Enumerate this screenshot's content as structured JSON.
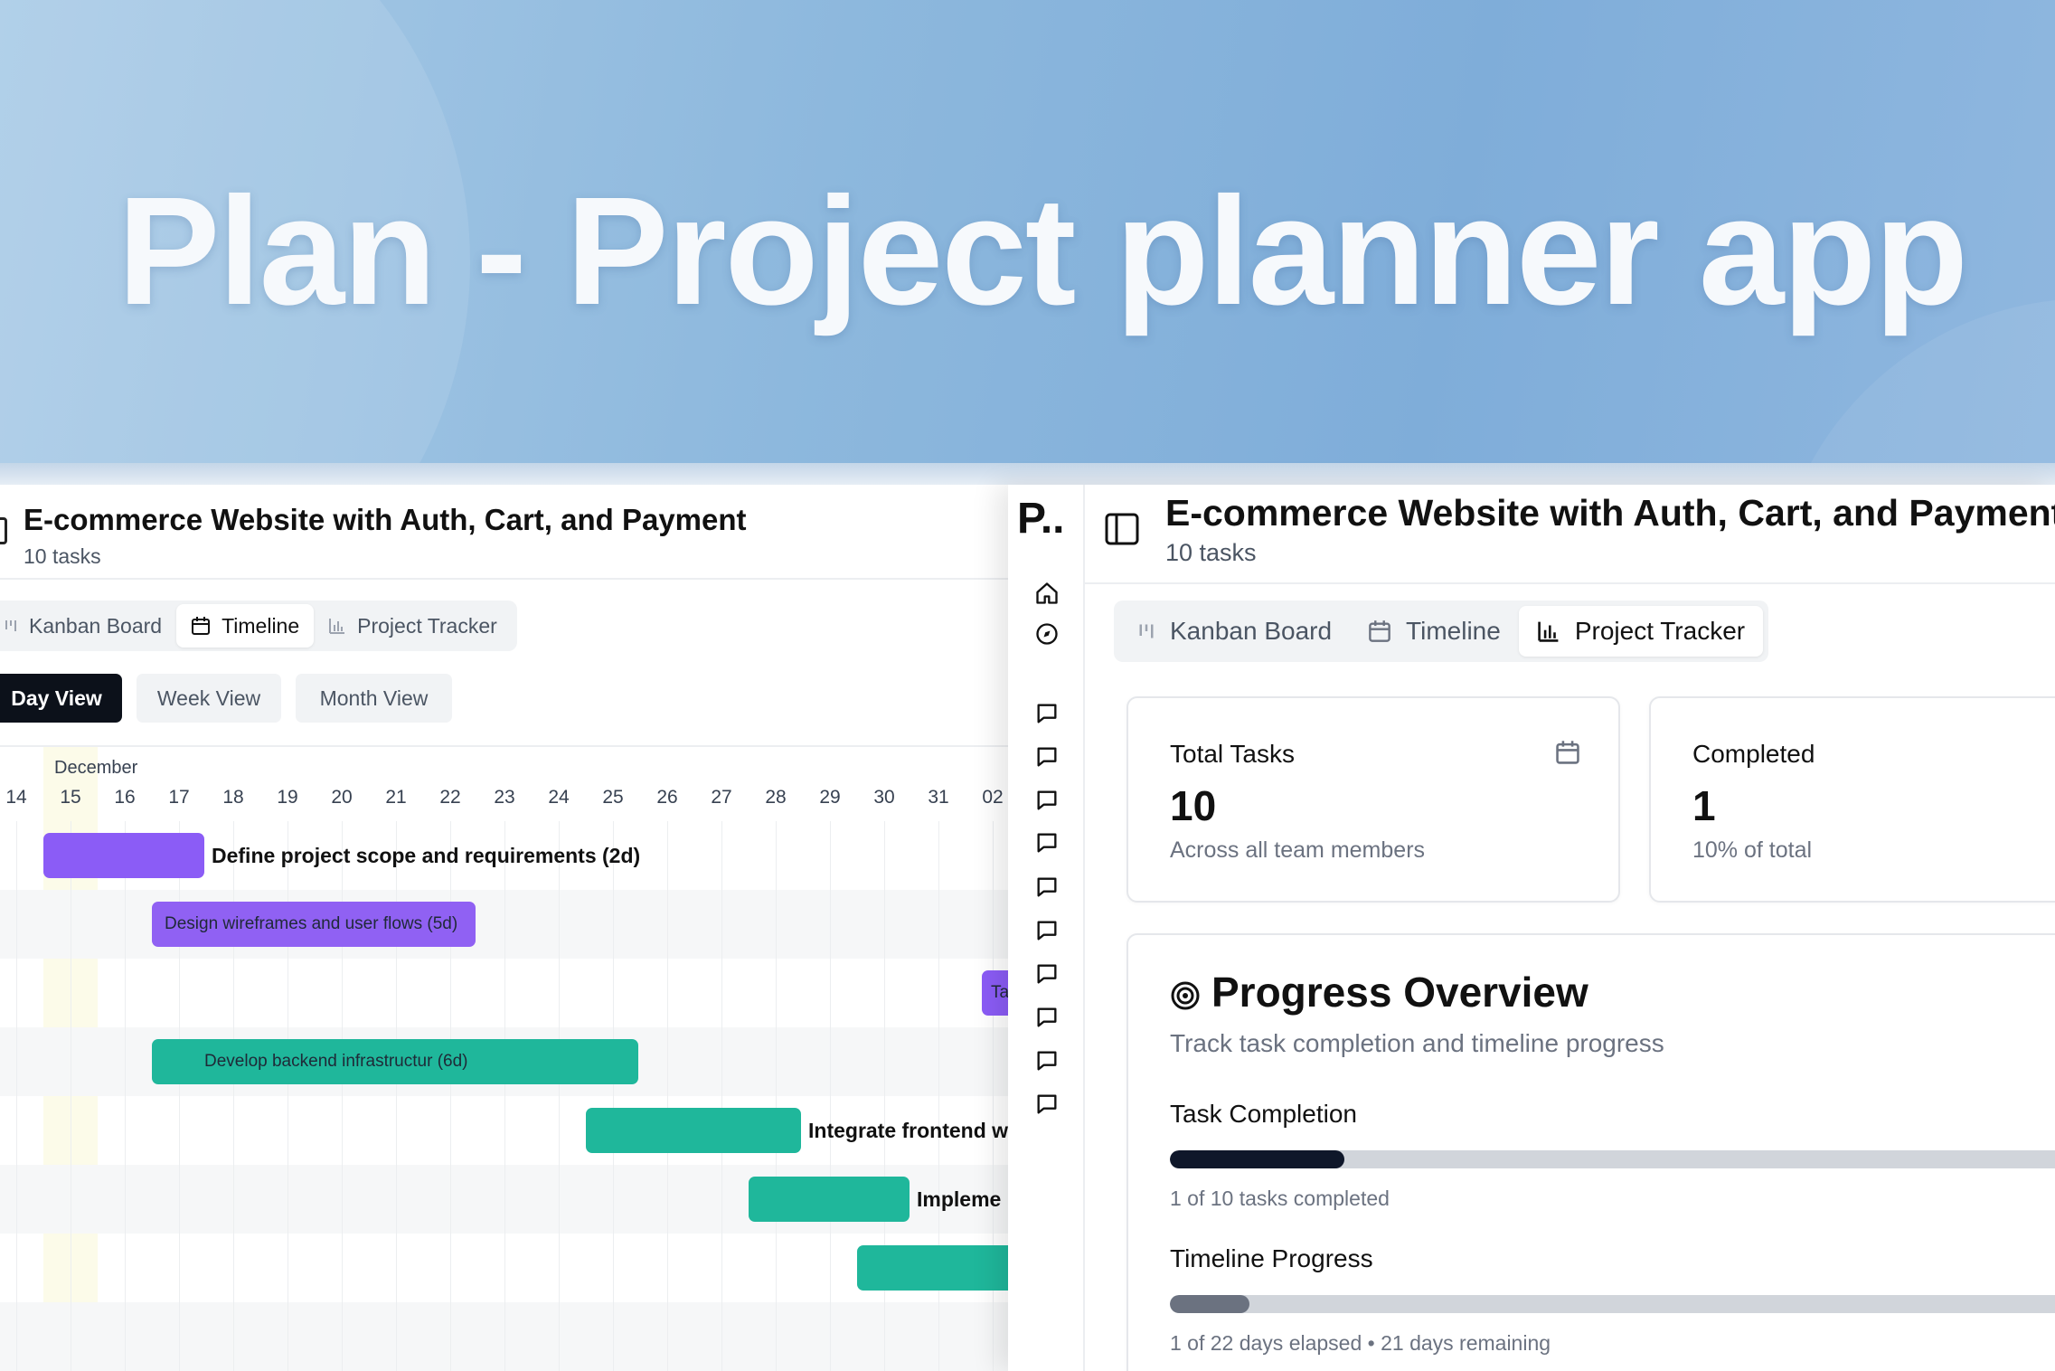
{
  "hero": {
    "title": "Plan - Project planner app"
  },
  "timeline_panel": {
    "project_title": "E-commerce Website with Auth, Cart, and Payment",
    "task_count": "10 tasks",
    "tabs": [
      {
        "label": "Kanban Board",
        "icon": "kanban-icon",
        "active": false
      },
      {
        "label": "Timeline",
        "icon": "calendar-icon",
        "active": true
      },
      {
        "label": "Project Tracker",
        "icon": "bar-chart-icon",
        "active": false
      }
    ],
    "view_buttons": [
      {
        "label": "Day View",
        "active": true
      },
      {
        "label": "Week View",
        "active": false
      },
      {
        "label": "Month View",
        "active": false
      }
    ],
    "month": "December",
    "days": [
      "14",
      "15",
      "16",
      "17",
      "18",
      "19",
      "20",
      "21",
      "22",
      "23",
      "24",
      "25",
      "26",
      "27",
      "28",
      "29",
      "30",
      "31",
      "02"
    ],
    "tasks": [
      {
        "label": "Define project scope and requirements (2d)",
        "color": "#8b5cf6",
        "start_day_index": 0.5,
        "duration_days": 3,
        "label_outside": true
      },
      {
        "label": "Design wireframes and user flows (5d)",
        "color": "#9061f3",
        "start_day_index": 2.5,
        "duration_days": 6,
        "label_outside": false
      },
      {
        "label": "Ta",
        "color": "#8b5cf6",
        "start_day_index": 17.8,
        "duration_days": 1,
        "label_outside": false
      },
      {
        "label": "Develop backend infrastructur (6d)",
        "color": "#1fb79b",
        "start_day_index": 2.5,
        "duration_days": 9,
        "label_outside": false
      },
      {
        "label": "Integrate frontend w",
        "color": "#1fb79b",
        "start_day_index": 10.5,
        "duration_days": 4,
        "label_outside": true
      },
      {
        "label": "Impleme",
        "color": "#1fb79b",
        "start_day_index": 13.5,
        "duration_days": 3,
        "label_outside": true
      },
      {
        "label": "",
        "color": "#1fb79b",
        "start_day_index": 15.5,
        "duration_days": 3,
        "label_outside": false
      }
    ]
  },
  "tracker_panel": {
    "brand": "P..",
    "project_title": "E-commerce Website with Auth, Cart, and Payment",
    "task_count": "10 tasks",
    "tabs": [
      {
        "label": "Kanban Board",
        "icon": "kanban-icon",
        "active": false
      },
      {
        "label": "Timeline",
        "icon": "calendar-icon",
        "active": false
      },
      {
        "label": "Project Tracker",
        "icon": "bar-chart-icon",
        "active": true
      }
    ],
    "sidebar_icons": [
      "home-icon",
      "compass-icon",
      "message-icon",
      "message-icon",
      "message-icon",
      "message-icon",
      "message-icon",
      "message-icon",
      "message-icon",
      "message-icon",
      "message-icon",
      "message-icon"
    ],
    "stats": {
      "total": {
        "label": "Total Tasks",
        "value": "10",
        "sub": "Across all team members"
      },
      "completed": {
        "label": "Completed",
        "value": "1",
        "sub": "10% of total"
      }
    },
    "progress": {
      "title": "Progress Overview",
      "subtitle": "Track task completion and timeline progress",
      "task_completion": {
        "label": "Task Completion",
        "fraction": 0.1,
        "caption": "1 of 10 tasks completed",
        "color": "#0f172a"
      },
      "timeline_progress": {
        "label": "Timeline Progress",
        "fraction": 0.05,
        "caption": "1 of 22 days elapsed • 21 days remaining",
        "color": "#6b7280"
      }
    }
  }
}
